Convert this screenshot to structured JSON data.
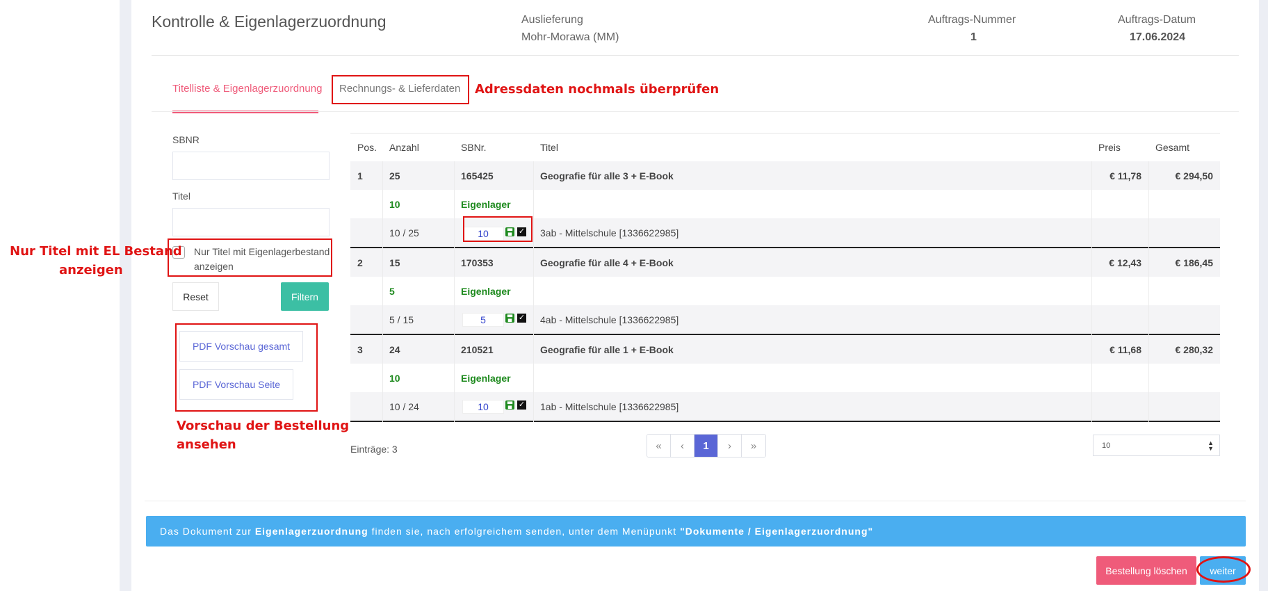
{
  "header": {
    "title": "Kontrolle & Eigenlagerzuordnung",
    "delivery_label": "Auslieferung",
    "delivery_value": "Mohr-Morawa (MM)",
    "order_number_label": "Auftrags-Nummer",
    "order_number_value": "1",
    "order_date_label": "Auftrags-Datum",
    "order_date_value": "17.06.2024"
  },
  "tabs": [
    {
      "label": "Titelliste & Eigenlagerzuordnung",
      "active": true
    },
    {
      "label": "Rechnungs- & Lieferdaten",
      "active": false
    }
  ],
  "annotations": {
    "address_check": "Adressdaten nochmals überprüfen",
    "el_stock_line1": "Nur Titel mit EL Bestand",
    "el_stock_line2": "anzeigen",
    "preview_line1": "Vorschau der Bestellung",
    "preview_line2": "ansehen"
  },
  "filters": {
    "sbnr_label": "SBNR",
    "sbnr_value": "",
    "title_label": "Titel",
    "title_value": "",
    "checkbox_label": "Nur Titel mit Eigenlagerbestand anzeigen",
    "checkbox_checked": false,
    "reset_label": "Reset",
    "filter_label": "Filtern",
    "pdf_total_label": "PDF Vorschau gesamt",
    "pdf_page_label": "PDF Vorschau Seite"
  },
  "table": {
    "headers": {
      "pos": "Pos.",
      "qty": "Anzahl",
      "sbnr": "SBNr.",
      "title": "Titel",
      "price": "Preis",
      "total": "Gesamt"
    },
    "items": [
      {
        "pos": "1",
        "qty": "25",
        "sbnr": "165425",
        "title": "Geografie für alle 3 + E-Book",
        "price": "€ 11,78",
        "total": "€ 294,50",
        "stock_qty": "10",
        "stock_label": "Eigenlager",
        "assign_ratio": "10 / 25",
        "assign_value": "10",
        "school": "3ab - Mittelschule [1336622985]"
      },
      {
        "pos": "2",
        "qty": "15",
        "sbnr": "170353",
        "title": "Geografie für alle 4 + E-Book",
        "price": "€ 12,43",
        "total": "€ 186,45",
        "stock_qty": "5",
        "stock_label": "Eigenlager",
        "assign_ratio": "5 / 15",
        "assign_value": "5",
        "school": "4ab - Mittelschule [1336622985]"
      },
      {
        "pos": "3",
        "qty": "24",
        "sbnr": "210521",
        "title": "Geografie für alle 1 + E-Book",
        "price": "€ 11,68",
        "total": "€ 280,32",
        "stock_qty": "10",
        "stock_label": "Eigenlager",
        "assign_ratio": "10 / 24",
        "assign_value": "10",
        "school": "1ab - Mittelschule [1336622985]"
      }
    ],
    "entries_label": "Einträge: 3"
  },
  "pagination": {
    "first": "«",
    "prev": "‹",
    "current": "1",
    "next": "›",
    "last": "»",
    "per_page": "10"
  },
  "info": {
    "text_1": "Das Dokument zur ",
    "text_bold_1": "Eigenlagerzuordnung",
    "text_2": " finden sie, nach erfolgreichem senden, unter dem Menüpunkt ",
    "text_bold_2": "\"Dokumente / Eigenlagerzuordnung\""
  },
  "actions": {
    "delete_label": "Bestellung löschen",
    "next_label": "weiter"
  },
  "colors": {
    "accent_pink": "#ef5b7a",
    "accent_teal": "#3cbfa4",
    "accent_blue": "#4aaef0",
    "stock_green": "#1e8a1e",
    "annotation_red": "#e01414"
  }
}
